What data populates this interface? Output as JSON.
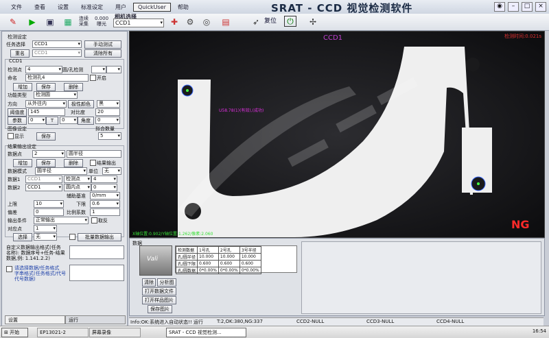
{
  "menu": [
    "文件",
    "查看",
    "设置",
    "标准设定",
    "用户",
    "QuickUser",
    "帮助"
  ],
  "app_title": "SRAT - CCD 视觉检测软件",
  "toolbar": {
    "buttons": [
      {
        "icon": "open-icon",
        "label": ""
      },
      {
        "icon": "run-icon",
        "label": "运行"
      },
      {
        "icon": "save-icon",
        "label": "保存"
      },
      {
        "icon": "image-icon",
        "label": "图像"
      }
    ],
    "trigger_label": "连续",
    "trigger_sub": "采集",
    "exposure_value": "0.000",
    "exposure_label": "曝光",
    "camera_label": "相机选择",
    "camera_value": "CCD1",
    "reset_label": "复位",
    "calib_label": "相机\n设置"
  },
  "left": {
    "section1": "检测设定",
    "task_label": "任务选择",
    "task_value": "CCD1",
    "manual_btn": "手动测试",
    "rename_btn": "重名",
    "rename_value": "CCD1",
    "clear_btn": "清除所有",
    "tab_label": "CCD1",
    "point_label": "检测点",
    "point_value": "4",
    "shape_label": "圆/孔检测",
    "name_label": "命名",
    "name_value": "检测孔4",
    "enable_label": "开启",
    "add_btn": "增加",
    "save_btn": "保存",
    "delete_btn": "删除",
    "func_label": "功能类型",
    "func_value": "检测圆",
    "dir_label": "方向",
    "dir_value": "从外往内",
    "polarity_btn": "极性颜色",
    "polarity_value": "黑",
    "threshold_btn": "阈值度",
    "threshold_value": "145",
    "contrast_label": "对比度",
    "contrast_value": "20",
    "param_btn": "参数",
    "param_value": "0",
    "t_label": "T",
    "t_value": "0",
    "angle_label": "角度",
    "angle_value": "0",
    "img_setting": "图像设定",
    "show_label": "显示",
    "save2_btn": "保存",
    "count_label": "拟合数量",
    "count_value": "5",
    "section2": "结果输出设定",
    "datapt_label": "数据点",
    "datapt_value": "2",
    "datapt_name": "圆半径",
    "add2_btn": "增加",
    "save3_btn": "保存",
    "delete2_btn": "删除",
    "noresult_label": "结果输出",
    "datamode_label": "数据模式",
    "datamode_value": "圆半径",
    "unit_label": "单位",
    "unit_value": "无",
    "data1_label": "数据1",
    "data1_value": "CCD1",
    "data1_pt": "检测点",
    "data1_pv": "4",
    "data2_label": "数据2",
    "data2_value": "CCD1",
    "data2_pt": "圆内点",
    "data2_pv": "0",
    "baseline_label": "辅助基准",
    "baseline_value": "0/mm",
    "upper_label": "上限",
    "upper_value": "10",
    "lower_label": "下限",
    "lower_value": "0.6",
    "offset_label": "偏差",
    "offset_value": "0",
    "ratio_label": "比例系数",
    "ratio_value": "1",
    "outcond_label": "输出条件",
    "outcond_value": "正常输出",
    "reverse_label": "取反",
    "pairpt_label": "对应点",
    "pairpt_value": "1",
    "choose_btn": "选择",
    "choose_value": "无",
    "export_btn": "批量数据输出",
    "hint1": "自定义数据输出格式(任务",
    "hint2": "名称): 数据序号+任务-结果",
    "hint3": "数据,例: 1.141.2.2)",
    "custom_label": "请选择数据/任务格式",
    "custom_sub": "字串格式(任务格式/代号",
    "custom_sub2": "代号数据)",
    "tab_setting": "设置",
    "tab_run": "运行"
  },
  "image": {
    "ccd_label": "CCD1",
    "time_label": "检测时间:0.021s",
    "overlay_label": "U58.78(1)(有效),(成功)",
    "status": "NG",
    "coord_text": "X轴位置:0.902/Y轴位置:1.262/像素:2.060"
  },
  "bottom": {
    "panel_label": "数据",
    "logo_text": "Vali",
    "table_headers": [
      "检测数据",
      "1号孔",
      "2号孔",
      "3号半径"
    ],
    "table_rows": [
      [
        "孔/圆半径",
        "10.000",
        "10.000",
        "10.000"
      ],
      [
        "孔/圆下限",
        "0.600",
        "0.600",
        "0.600"
      ],
      [
        "孔/圆数据",
        "0*0.00%",
        "0*0.00%",
        "0*0.00%"
      ]
    ],
    "btn_clear": "清除",
    "btn_analysis": "分析图",
    "btn_open_data": "打开数据文件",
    "btn_open_img": "打开样品图片",
    "btn_save_img": "保存图片"
  },
  "status": {
    "msg": "Info:OK:系统进入自动状态!! 运行",
    "t1": "T:2,OK:380,NG:337",
    "ccd2": "CCD2-NULL",
    "ccd3": "CCD3-NULL",
    "ccd4": "CCD4-NULL"
  },
  "taskbar": {
    "start": "开始",
    "item1": "EP13021-2",
    "item2": "屏幕录像",
    "item3": "SRAT - CCD 视觉检测...",
    "clock": "16:54"
  },
  "colors": {
    "ng_red": "#ff2a2a",
    "overlay_magenta": "#e030e0",
    "coord_green": "#38e038",
    "part_white": "#f2f2f2"
  }
}
